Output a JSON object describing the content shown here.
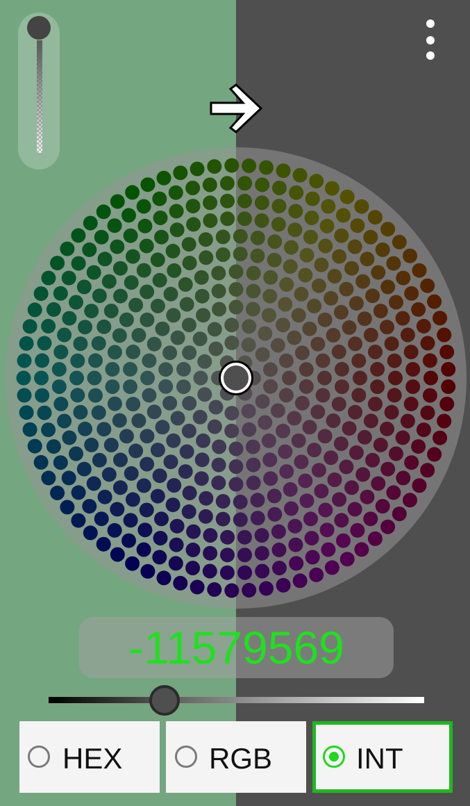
{
  "color_value": "-11579569",
  "modes": [
    {
      "label": "HEX",
      "selected": false
    },
    {
      "label": "RGB",
      "selected": false
    },
    {
      "label": "INT",
      "selected": true
    }
  ],
  "selected_color": "#4f4f4f",
  "previous_color": "#74a67f",
  "value_text_color": "#1fe01f",
  "accent_color": "#1eb81e",
  "icons": [
    "more-vert-icon",
    "arrow-right-icon"
  ],
  "alpha_level": 1.0,
  "brightness_level": 0.31
}
